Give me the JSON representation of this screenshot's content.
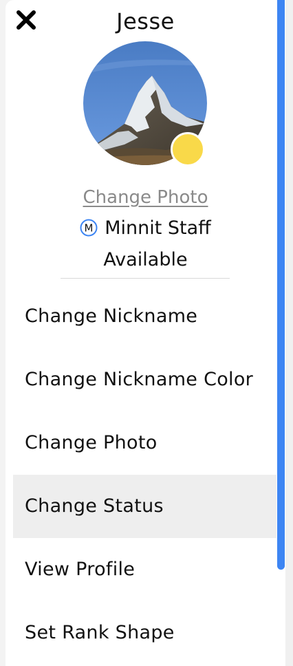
{
  "header": {
    "user_name": "Jesse"
  },
  "avatar": {
    "photo": "mountain-peak-photo",
    "status_color": "#f9d949"
  },
  "profile": {
    "change_photo_link": "Change Photo",
    "staff_badge_letter": "M",
    "staff_label": "Minnit Staff",
    "status": "Available"
  },
  "menu": {
    "items": [
      {
        "label": "Change Nickname"
      },
      {
        "label": "Change Nickname Color"
      },
      {
        "label": "Change Photo"
      },
      {
        "label": "Change Status"
      },
      {
        "label": "View Profile"
      },
      {
        "label": "Set Rank Shape"
      }
    ],
    "active_index": 3
  },
  "colors": {
    "accent": "#3d85f3",
    "status_available": "#f9d949",
    "link_gray": "#8a8a8a"
  }
}
